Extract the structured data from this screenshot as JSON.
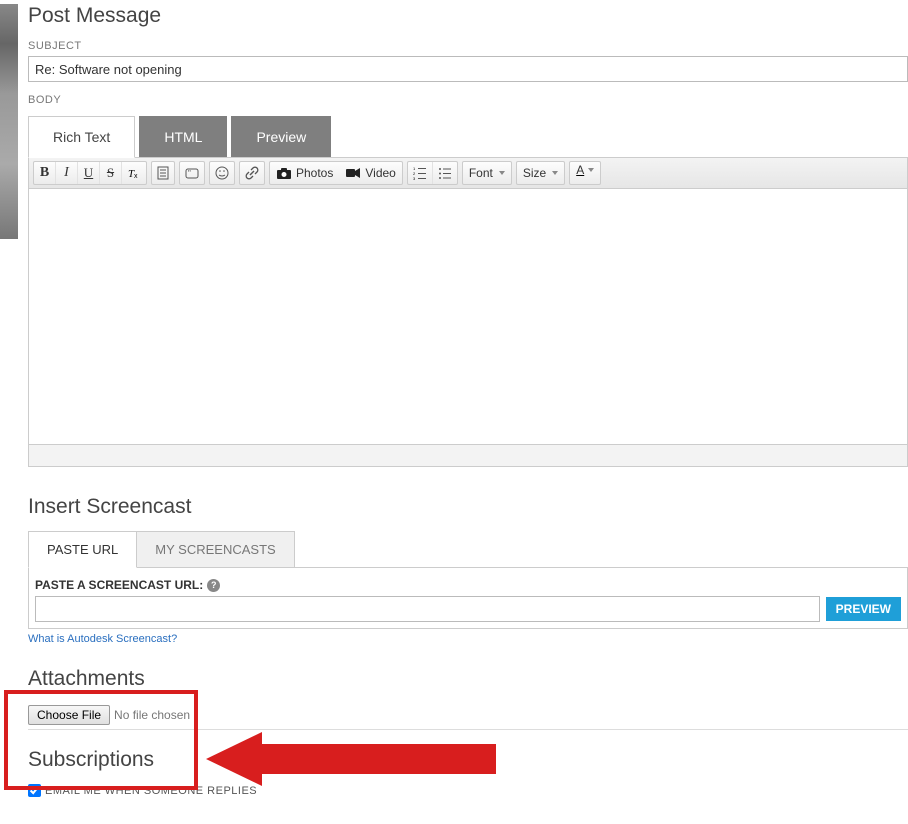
{
  "header": {
    "title": "Post Message"
  },
  "subject": {
    "label": "SUBJECT",
    "value": "Re: Software not opening"
  },
  "body": {
    "label": "BODY"
  },
  "tabs": {
    "rich": "Rich Text",
    "html": "HTML",
    "preview": "Preview"
  },
  "toolbar": {
    "bold": "B",
    "italic": "I",
    "under": "U",
    "strike": "S",
    "photos": "Photos",
    "video": "Video",
    "font": "Font",
    "size": "Size",
    "color": "A"
  },
  "screencast": {
    "title": "Insert Screencast",
    "tab_paste": "PASTE URL",
    "tab_my": "MY SCREENCASTS",
    "label": "PASTE A SCREENCAST URL:",
    "preview_btn": "PREVIEW",
    "help_link": "What is Autodesk Screencast?"
  },
  "attachments": {
    "title": "Attachments",
    "choose": "Choose File",
    "status": "No file chosen"
  },
  "subscriptions": {
    "title": "Subscriptions",
    "opt1": "EMAIL ME WHEN SOMEONE REPLIES"
  }
}
